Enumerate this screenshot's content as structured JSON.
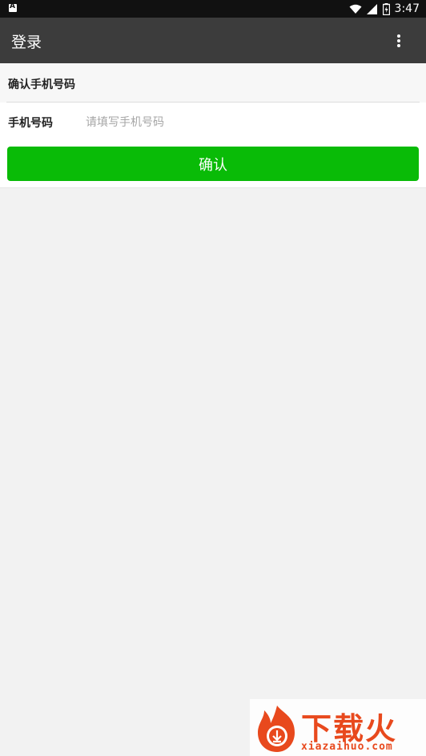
{
  "status_bar": {
    "time": "3:47"
  },
  "app_bar": {
    "title": "登录"
  },
  "section": {
    "title": "确认手机号码"
  },
  "phone_field": {
    "label": "手机号码",
    "value": "",
    "placeholder": "请填写手机号码"
  },
  "confirm_button": {
    "label": "确认"
  },
  "watermark": {
    "cn_text": "下载火",
    "en_text": "xiazaihuo.com"
  },
  "colors": {
    "app_bar": "#3c3c3c",
    "primary_button": "#09bb07",
    "watermark": "#e8491d"
  }
}
